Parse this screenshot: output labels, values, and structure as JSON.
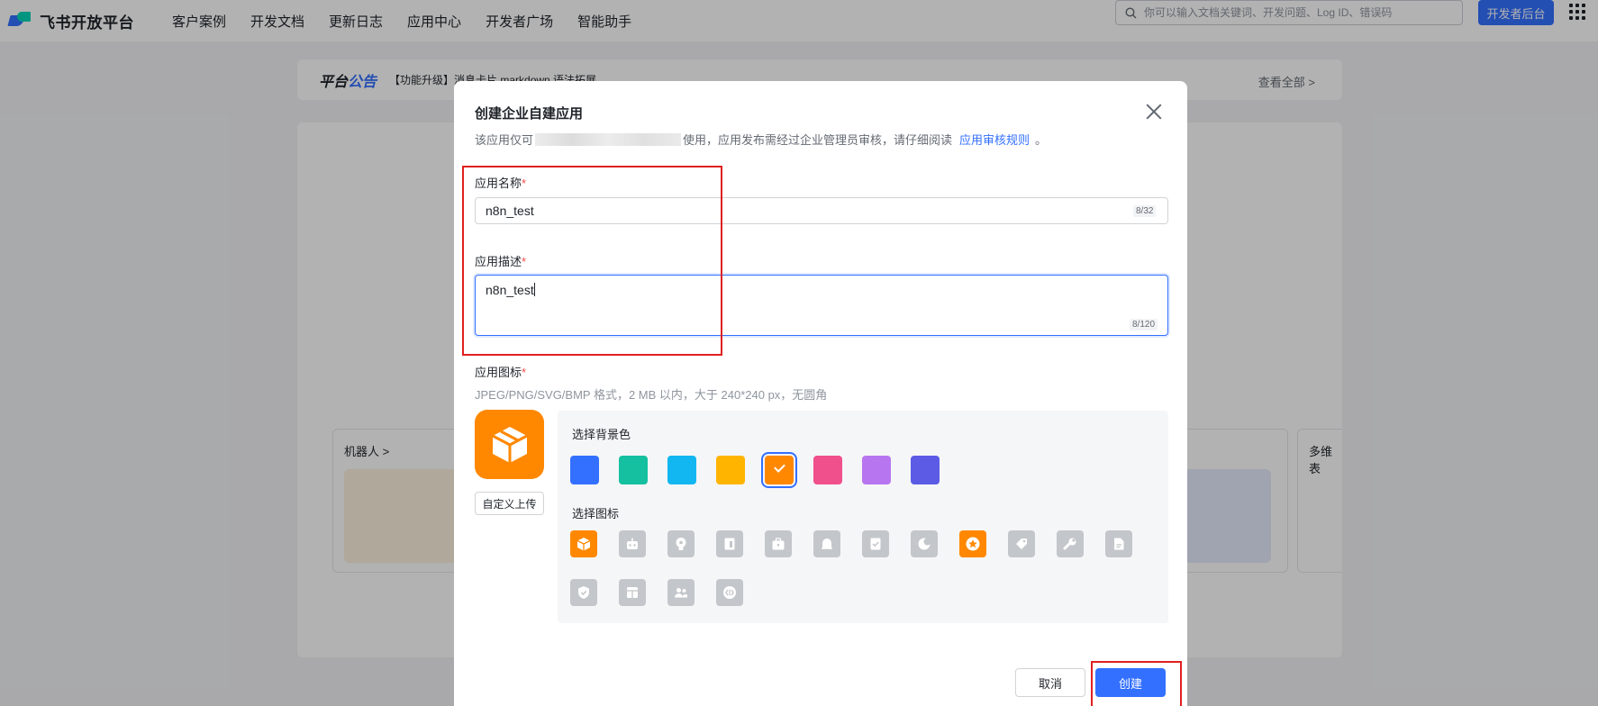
{
  "topnav": {
    "brand": "飞书开放平台",
    "links": [
      "客户案例",
      "开发文档",
      "更新日志",
      "应用中心",
      "开发者广场",
      "智能助手"
    ],
    "search_placeholder": "你可以输入文档关键词、开发问题、Log ID、错误码",
    "dev_console": "开发者后台"
  },
  "notice": {
    "title_prefix": "平台",
    "title_highlight": "公告",
    "text": "【功能升级】消息卡片 markdown 语法拓展",
    "view_all": "查看全部 >"
  },
  "cards": {
    "bot_title": "机器人 >",
    "right_title": "多维表"
  },
  "modal": {
    "title": "创建企业自建应用",
    "subtitle_before": "该应用仅可",
    "subtitle_after": "使用，应用发布需经过企业管理员审核，请仔细阅读",
    "rule_link": "应用审核规则",
    "subtitle_end": "。",
    "name_label": "应用名称",
    "name_value": "n8n_test",
    "name_counter": "8/32",
    "desc_label": "应用描述",
    "desc_value": "n8n_test",
    "desc_counter": "8/120",
    "icon_label": "应用图标",
    "required_mark": "*",
    "icon_hint": "JPEG/PNG/SVG/BMP 格式，2 MB 以内，大于 240*240 px，无圆角",
    "upload_button": "自定义上传",
    "bg_color_label": "选择背景色",
    "icon_choice_label": "选择图标",
    "bg_colors": [
      "#3370ff",
      "#14c0a0",
      "#12b6f0",
      "#ffb400",
      "#ff8800",
      "#f0508c",
      "#b875f0",
      "#5b5be6"
    ],
    "selected_bg_color": "#ff8800",
    "icons": [
      "box-icon",
      "robot-icon",
      "bulb-icon",
      "document-icon",
      "briefcase-icon",
      "bell-icon",
      "checklist-icon",
      "moon-icon",
      "star-icon",
      "tag-icon",
      "wrench-icon",
      "file-icon",
      "shield-icon",
      "layout-icon",
      "people-icon",
      "code-icon"
    ],
    "selected_icon": "box-icon",
    "cancel_button": "取消",
    "create_button": "创建"
  }
}
